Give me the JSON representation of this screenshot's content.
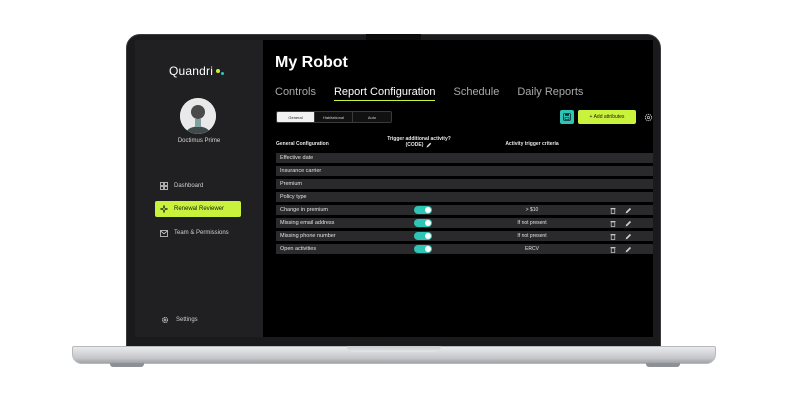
{
  "app": {
    "brand": "Quandri",
    "user_name": "Doctimus Prime"
  },
  "sidebar": {
    "items": [
      {
        "label": "Dashboard",
        "icon": "grid-icon",
        "active": false
      },
      {
        "label": "Renewal Reviewer",
        "icon": "sparkle-icon",
        "active": true
      },
      {
        "label": "Team & Permissions",
        "icon": "mail-icon",
        "active": false
      }
    ],
    "settings_label": "Settings"
  },
  "header": {
    "title": "My Robot",
    "tabs": [
      {
        "label": "Controls",
        "active": false
      },
      {
        "label": "Report Configuration",
        "active": true
      },
      {
        "label": "Schedule",
        "active": false
      },
      {
        "label": "Daily Reports",
        "active": false
      }
    ]
  },
  "segments": [
    {
      "label": "General",
      "active": true
    },
    {
      "label": "Habitational",
      "active": false
    },
    {
      "label": "Auto",
      "active": false
    }
  ],
  "toolbar": {
    "add_label": "+ Add attributes"
  },
  "table": {
    "headers": {
      "config": "General Configuration",
      "trigger_line1": "Trigger additional activity?",
      "trigger_line2": "(CODE)",
      "criteria": "Activity trigger criteria"
    },
    "rows": [
      {
        "label": "Effective date",
        "toggle": false,
        "criteria": "",
        "actions": false
      },
      {
        "label": "Insurance carrier",
        "toggle": false,
        "criteria": "",
        "actions": false
      },
      {
        "label": "Premium",
        "toggle": false,
        "criteria": "",
        "actions": false
      },
      {
        "label": "Policy type",
        "toggle": false,
        "criteria": "",
        "actions": false
      },
      {
        "label": "Change in premium",
        "toggle": true,
        "criteria": "> $10",
        "actions": true
      },
      {
        "label": "Missing email address",
        "toggle": true,
        "criteria": "If not present",
        "actions": true
      },
      {
        "label": "Missing phone number",
        "toggle": true,
        "criteria": "If not present",
        "actions": true
      },
      {
        "label": "Open activities",
        "toggle": true,
        "criteria": "ERCV",
        "actions": true
      }
    ]
  },
  "colors": {
    "accent_lime": "#c8f23c",
    "accent_teal": "#2ec4b6",
    "panel": "#202022",
    "row": "#2a2a2c"
  }
}
